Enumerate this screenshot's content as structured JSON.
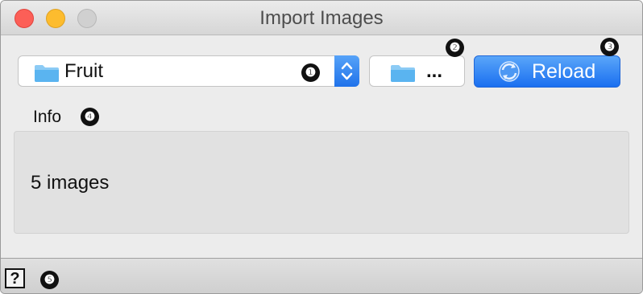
{
  "window": {
    "title": "Import Images"
  },
  "controls": {
    "directory_select": {
      "value": "Fruit",
      "icon": "folder-icon"
    },
    "browse_button": {
      "label": "...",
      "icon": "folder-icon"
    },
    "reload_button": {
      "label": "Reload",
      "icon": "refresh-icon"
    }
  },
  "info": {
    "label": "Info",
    "text": "5 images"
  },
  "callouts": [
    "❶",
    "❷",
    "❸",
    "❹",
    "❺"
  ],
  "statusbar": {
    "help_label": "?"
  },
  "colors": {
    "accent": "#1a6ff0",
    "folder": "#5ab4f0"
  }
}
